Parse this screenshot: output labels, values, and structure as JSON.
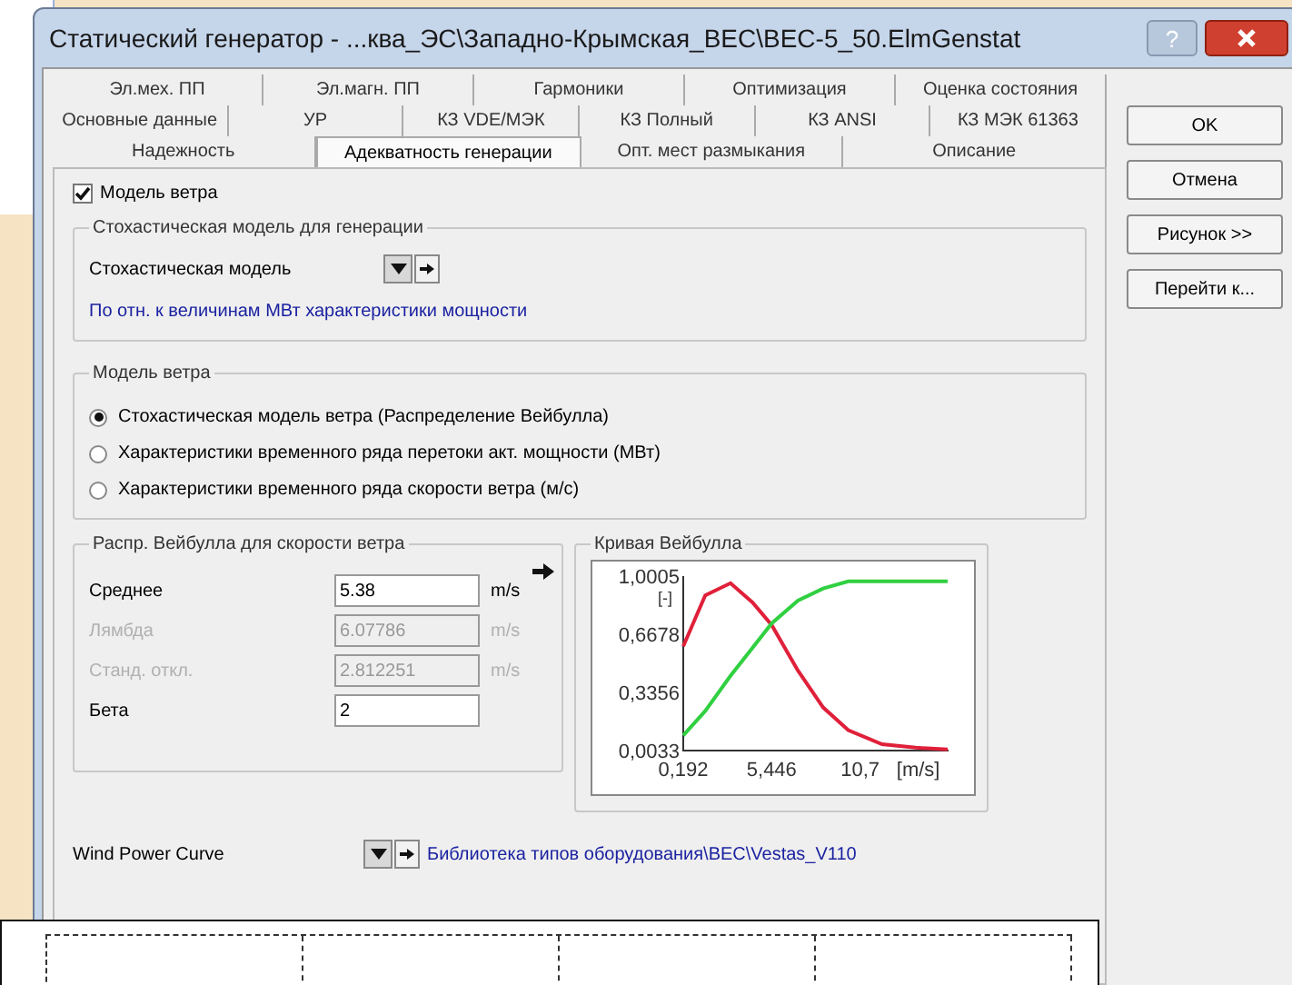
{
  "window": {
    "title": "Статический генератор - ...ква_ЭС\\Западно-Крымская_ВЕС\\ВЕС-5_50.ElmGenstat",
    "help_button": "?"
  },
  "tab_rows": [
    {
      "tabs": [
        {
          "label": "Эл.мех. ПП",
          "selected": false
        },
        {
          "label": "Эл.магн. ПП",
          "selected": false
        },
        {
          "label": "Гармоники",
          "selected": false
        },
        {
          "label": "Оптимизация",
          "selected": false
        },
        {
          "label": "Оценка состояния",
          "selected": false
        }
      ]
    },
    {
      "tabs": [
        {
          "label": "Основные данные",
          "selected": false
        },
        {
          "label": "УР",
          "selected": false
        },
        {
          "label": "КЗ VDE/МЭК",
          "selected": false
        },
        {
          "label": "КЗ Полный",
          "selected": false
        },
        {
          "label": "КЗ ANSI",
          "selected": false
        },
        {
          "label": "КЗ МЭК 61363",
          "selected": false
        }
      ]
    },
    {
      "tabs": [
        {
          "label": "Надежность",
          "selected": false
        },
        {
          "label": "Адекватность генерации",
          "selected": true
        },
        {
          "label": "Опт. мест размыкания",
          "selected": false
        },
        {
          "label": "Описание",
          "selected": false
        }
      ]
    }
  ],
  "side_buttons": [
    "OK",
    "Отмена",
    "Рисунок >>",
    "Перейти к..."
  ],
  "wind_model_checkbox": {
    "label": "Модель ветра",
    "checked": true
  },
  "stochastic_group": {
    "title": "Стохастическая модель для генерации",
    "field_label": "Стохастическая модель",
    "note": "По отн. к величинам МВт характеристики мощности"
  },
  "wind_model_group": {
    "title": "Модель ветра",
    "options": [
      {
        "label": "Стохастическая модель ветра (Распределение Вейбулла)",
        "selected": true
      },
      {
        "label": "Характеристики временного ряда перетоки акт. мощности (МВт)",
        "selected": false
      },
      {
        "label": "Характеристики временного ряда скорости ветра (м/с)",
        "selected": false
      }
    ]
  },
  "weibull_group": {
    "title": "Распр. Вейбулла для скорости ветра",
    "params": [
      {
        "label": "Среднее",
        "value": "5.38",
        "unit": "m/s",
        "disabled": false
      },
      {
        "label": "Лямбда",
        "value": "6.07786",
        "unit": "m/s",
        "disabled": true
      },
      {
        "label": "Станд. откл.",
        "value": "2.812251",
        "unit": "m/s",
        "disabled": true
      },
      {
        "label": "Бета",
        "value": "2",
        "disabled": false
      }
    ]
  },
  "weibull_chart": {
    "title": "Кривая Вейбулла",
    "chart_data": {
      "type": "line",
      "ylabel": "[-]",
      "xlabel": "[m/s]",
      "x": [
        0.192,
        1.5,
        3,
        4.3,
        5.446,
        7,
        8.5,
        10,
        12,
        14,
        15.9
      ],
      "series": [
        {
          "color": "#e0203a",
          "values": [
            0.6,
            0.89,
            0.96,
            0.85,
            0.72,
            0.46,
            0.25,
            0.12,
            0.04,
            0.02,
            0.01
          ]
        },
        {
          "color": "#30d040",
          "values": [
            0.09,
            0.23,
            0.43,
            0.59,
            0.73,
            0.86,
            0.93,
            0.97,
            0.97,
            0.97,
            0.97
          ]
        }
      ],
      "xlim": [
        0.192,
        15.954
      ],
      "ylim": [
        0.0033,
        1.0005
      ],
      "xticks": [
        {
          "value": 0.192,
          "label": "0,192"
        },
        {
          "value": 5.446,
          "label": "5,446"
        },
        {
          "value": 10.7,
          "label": "10,7"
        }
      ],
      "yticks": [
        {
          "value": 0.0033,
          "label": "0,0033"
        },
        {
          "value": 0.3356,
          "label": "0,3356"
        },
        {
          "value": 0.6678,
          "label": "0,6678"
        },
        {
          "value": 1.0005,
          "label": "1,0005"
        }
      ]
    }
  },
  "power_curve": {
    "label": "Wind Power Curve",
    "link": "Библиотека типов оборудования\\ВЕС\\Vestas_V110"
  }
}
